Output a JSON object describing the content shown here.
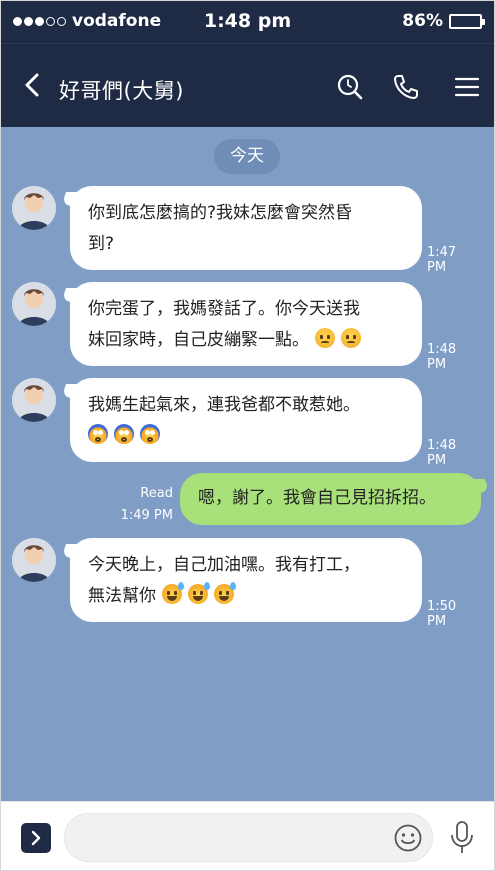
{
  "status": {
    "carrier": "vodafone",
    "time": "1:48 pm",
    "battery": "86%",
    "battery_level": 0.86,
    "signal_bars": 3,
    "signal_total": 5
  },
  "nav": {
    "title": "好哥們(大舅)",
    "back_icon": "chevron-left-icon",
    "search_icon": "search-icon",
    "call_icon": "phone-icon",
    "menu_icon": "menu-icon"
  },
  "chat": {
    "date_label": "今天",
    "background": "#7f9dc5",
    "messages": [
      {
        "side": "them",
        "lines": [
          "你到底怎麼搞的?我妹怎麼會突然昏",
          "到?"
        ],
        "time": "1:47 PM"
      },
      {
        "side": "them",
        "lines": [
          "你完蛋了，我媽發話了。你今天送我",
          "妹回家時，自己皮繃緊一點。"
        ],
        "emoji": "sad-face-icon",
        "time": "1:48 PM"
      },
      {
        "side": "them",
        "lines": [
          "我媽生起氣來，連我爸都不敢惹她。",
          ""
        ],
        "emoji": "shocked-face-icon",
        "time": "1:48 PM"
      },
      {
        "side": "me",
        "lines": [
          "嗯，謝了。我會自己見招拆招。"
        ],
        "read": "Read",
        "time": "1:49 PM"
      },
      {
        "side": "them",
        "lines": [
          "今天晚上，自己加油嘿。我有打工，",
          "無法幫你"
        ],
        "emoji": "sweat-smile-icon",
        "time": "1:50 PM"
      }
    ]
  },
  "input": {
    "placeholder": "",
    "expand_icon": "chevron-right-icon",
    "emoji_icon": "smiley-icon",
    "mic_icon": "microphone-icon"
  }
}
